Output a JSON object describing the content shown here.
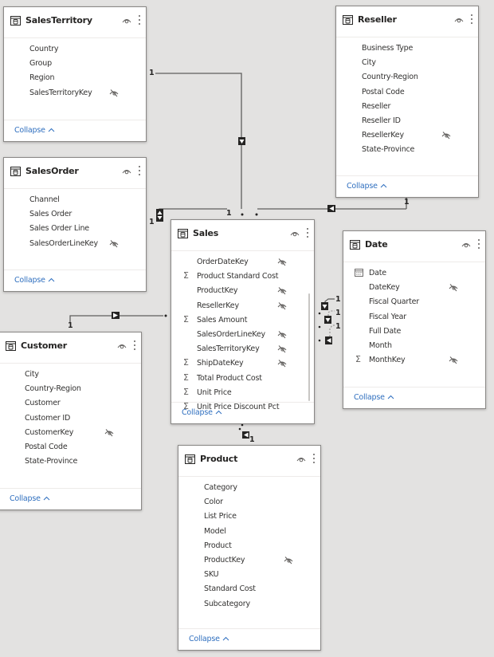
{
  "tables": {
    "salesTerritory": {
      "title": "SalesTerritory",
      "fields": [
        {
          "name": "Country",
          "hidden": false,
          "icon": ""
        },
        {
          "name": "Group",
          "hidden": false,
          "icon": ""
        },
        {
          "name": "Region",
          "hidden": false,
          "icon": ""
        },
        {
          "name": "SalesTerritoryKey",
          "hidden": true,
          "icon": ""
        }
      ],
      "collapse_label": "Collapse"
    },
    "reseller": {
      "title": "Reseller",
      "fields": [
        {
          "name": "Business Type",
          "hidden": false,
          "icon": ""
        },
        {
          "name": "City",
          "hidden": false,
          "icon": ""
        },
        {
          "name": "Country-Region",
          "hidden": false,
          "icon": ""
        },
        {
          "name": "Postal Code",
          "hidden": false,
          "icon": ""
        },
        {
          "name": "Reseller",
          "hidden": false,
          "icon": ""
        },
        {
          "name": "Reseller ID",
          "hidden": false,
          "icon": ""
        },
        {
          "name": "ResellerKey",
          "hidden": true,
          "icon": ""
        },
        {
          "name": "State-Province",
          "hidden": false,
          "icon": ""
        }
      ],
      "collapse_label": "Collapse"
    },
    "salesOrder": {
      "title": "SalesOrder",
      "fields": [
        {
          "name": "Channel",
          "hidden": false,
          "icon": ""
        },
        {
          "name": "Sales Order",
          "hidden": false,
          "icon": ""
        },
        {
          "name": "Sales Order Line",
          "hidden": false,
          "icon": ""
        },
        {
          "name": "SalesOrderLineKey",
          "hidden": true,
          "icon": ""
        }
      ],
      "collapse_label": "Collapse"
    },
    "sales": {
      "title": "Sales",
      "fields": [
        {
          "name": "OrderDateKey",
          "hidden": true,
          "icon": ""
        },
        {
          "name": "Product Standard Cost",
          "hidden": false,
          "icon": "sigma"
        },
        {
          "name": "ProductKey",
          "hidden": true,
          "icon": ""
        },
        {
          "name": "ResellerKey",
          "hidden": true,
          "icon": ""
        },
        {
          "name": "Sales Amount",
          "hidden": false,
          "icon": "sigma"
        },
        {
          "name": "SalesOrderLineKey",
          "hidden": true,
          "icon": ""
        },
        {
          "name": "SalesTerritoryKey",
          "hidden": true,
          "icon": ""
        },
        {
          "name": "ShipDateKey",
          "hidden": true,
          "icon": "sigma"
        },
        {
          "name": "Total Product Cost",
          "hidden": false,
          "icon": "sigma"
        },
        {
          "name": "Unit Price",
          "hidden": false,
          "icon": "sigma"
        },
        {
          "name": "Unit Price Discount Pct",
          "hidden": false,
          "icon": "sigma"
        }
      ],
      "collapse_label": "Collapse"
    },
    "date": {
      "title": "Date",
      "fields": [
        {
          "name": "Date",
          "hidden": false,
          "icon": "calendar"
        },
        {
          "name": "DateKey",
          "hidden": true,
          "icon": ""
        },
        {
          "name": "Fiscal Quarter",
          "hidden": false,
          "icon": ""
        },
        {
          "name": "Fiscal Year",
          "hidden": false,
          "icon": ""
        },
        {
          "name": "Full Date",
          "hidden": false,
          "icon": ""
        },
        {
          "name": "Month",
          "hidden": false,
          "icon": ""
        },
        {
          "name": "MonthKey",
          "hidden": true,
          "icon": "sigma"
        }
      ],
      "collapse_label": "Collapse"
    },
    "customer": {
      "title": "Customer",
      "fields": [
        {
          "name": "City",
          "hidden": false,
          "icon": ""
        },
        {
          "name": "Country-Region",
          "hidden": false,
          "icon": ""
        },
        {
          "name": "Customer",
          "hidden": false,
          "icon": ""
        },
        {
          "name": "Customer ID",
          "hidden": false,
          "icon": ""
        },
        {
          "name": "CustomerKey",
          "hidden": true,
          "icon": ""
        },
        {
          "name": "Postal Code",
          "hidden": false,
          "icon": ""
        },
        {
          "name": "State-Province",
          "hidden": false,
          "icon": ""
        }
      ],
      "collapse_label": "Collapse"
    },
    "product": {
      "title": "Product",
      "fields": [
        {
          "name": "Category",
          "hidden": false,
          "icon": ""
        },
        {
          "name": "Color",
          "hidden": false,
          "icon": ""
        },
        {
          "name": "List Price",
          "hidden": false,
          "icon": ""
        },
        {
          "name": "Model",
          "hidden": false,
          "icon": ""
        },
        {
          "name": "Product",
          "hidden": false,
          "icon": ""
        },
        {
          "name": "ProductKey",
          "hidden": true,
          "icon": ""
        },
        {
          "name": "SKU",
          "hidden": false,
          "icon": ""
        },
        {
          "name": "Standard Cost",
          "hidden": false,
          "icon": ""
        },
        {
          "name": "Subcategory",
          "hidden": false,
          "icon": ""
        }
      ],
      "collapse_label": "Collapse"
    }
  },
  "relationships": [
    {
      "from": "SalesTerritory",
      "to": "Sales",
      "one_label": "1",
      "many_label": "*",
      "direction": "single"
    },
    {
      "from": "SalesOrder",
      "to": "Sales",
      "one_label": "1",
      "many_label": "1",
      "direction": "both"
    },
    {
      "from": "Reseller",
      "to": "Sales",
      "one_label": "1",
      "many_label": "*",
      "direction": "single"
    },
    {
      "from": "Customer",
      "to": "Sales",
      "one_label": "1",
      "many_label": "*",
      "direction": "single"
    },
    {
      "from": "Date",
      "to": "Sales",
      "one_label": "1",
      "many_label": "*",
      "direction": "single",
      "active": true
    },
    {
      "from": "Date",
      "to": "Sales",
      "one_label": "1",
      "many_label": "*",
      "direction": "single",
      "active": false
    },
    {
      "from": "Date",
      "to": "Sales",
      "one_label": "1",
      "many_label": "*",
      "direction": "single",
      "active": false
    },
    {
      "from": "Product",
      "to": "Sales",
      "one_label": "1",
      "many_label": "*",
      "direction": "single"
    }
  ],
  "labels": {
    "one": "1"
  }
}
